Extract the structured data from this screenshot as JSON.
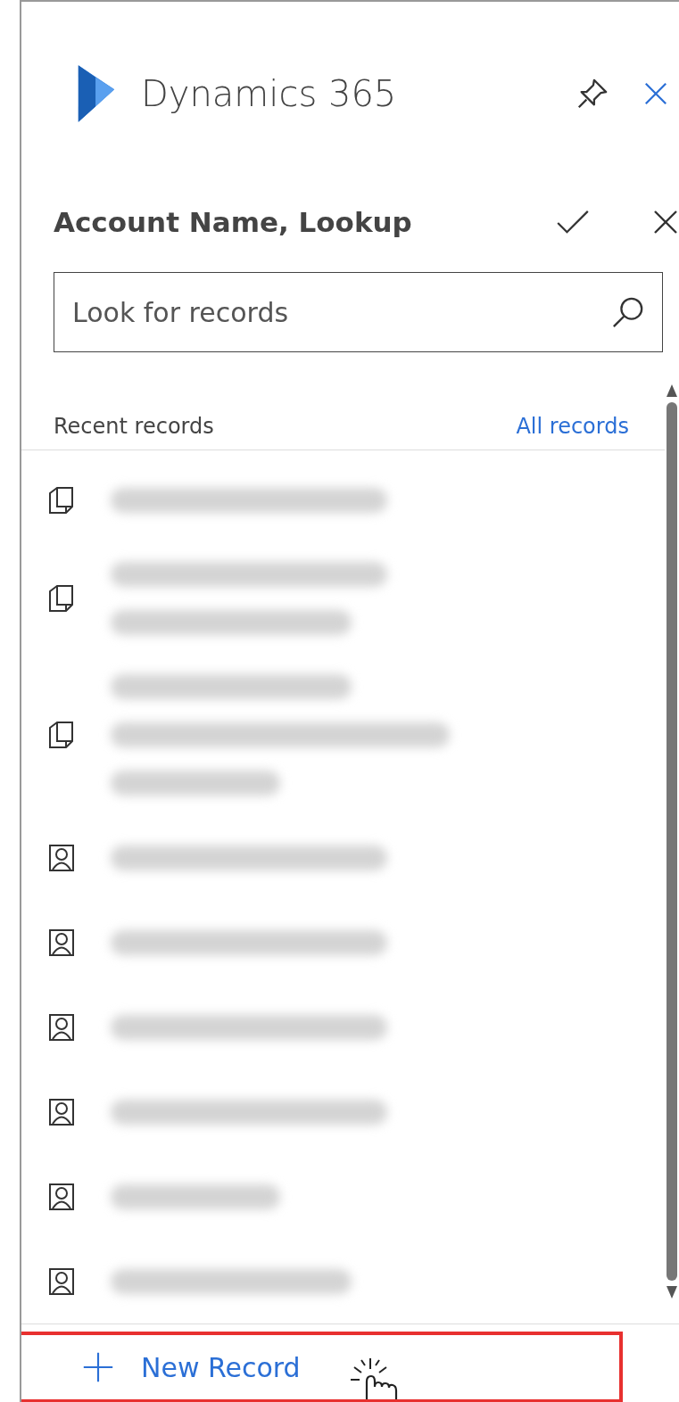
{
  "header": {
    "title": "Dynamics 365"
  },
  "lookup": {
    "title": "Account Name, Lookup"
  },
  "search": {
    "placeholder": "Look for records"
  },
  "records_header": {
    "label": "Recent records",
    "link": "All records"
  },
  "records": [
    {
      "kind": "account",
      "redacted_lines": [
        {
          "kind": "long"
        }
      ]
    },
    {
      "kind": "account",
      "redacted_lines": [
        {
          "kind": "long"
        },
        {
          "kind": "medium"
        }
      ]
    },
    {
      "kind": "account",
      "redacted_lines": [
        {
          "kind": "medium"
        },
        {
          "kind": "wide"
        },
        {
          "kind": "short"
        }
      ]
    },
    {
      "kind": "contact",
      "redacted_lines": [
        {
          "kind": "long"
        }
      ]
    },
    {
      "kind": "contact",
      "redacted_lines": [
        {
          "kind": "long"
        }
      ]
    },
    {
      "kind": "contact",
      "redacted_lines": [
        {
          "kind": "long"
        }
      ]
    },
    {
      "kind": "contact",
      "redacted_lines": [
        {
          "kind": "long"
        }
      ]
    },
    {
      "kind": "contact",
      "redacted_lines": [
        {
          "kind": "short"
        }
      ]
    },
    {
      "kind": "contact",
      "redacted_lines": [
        {
          "kind": "medium"
        }
      ]
    }
  ],
  "footer": {
    "label": "New Record",
    "highlighted": true
  }
}
